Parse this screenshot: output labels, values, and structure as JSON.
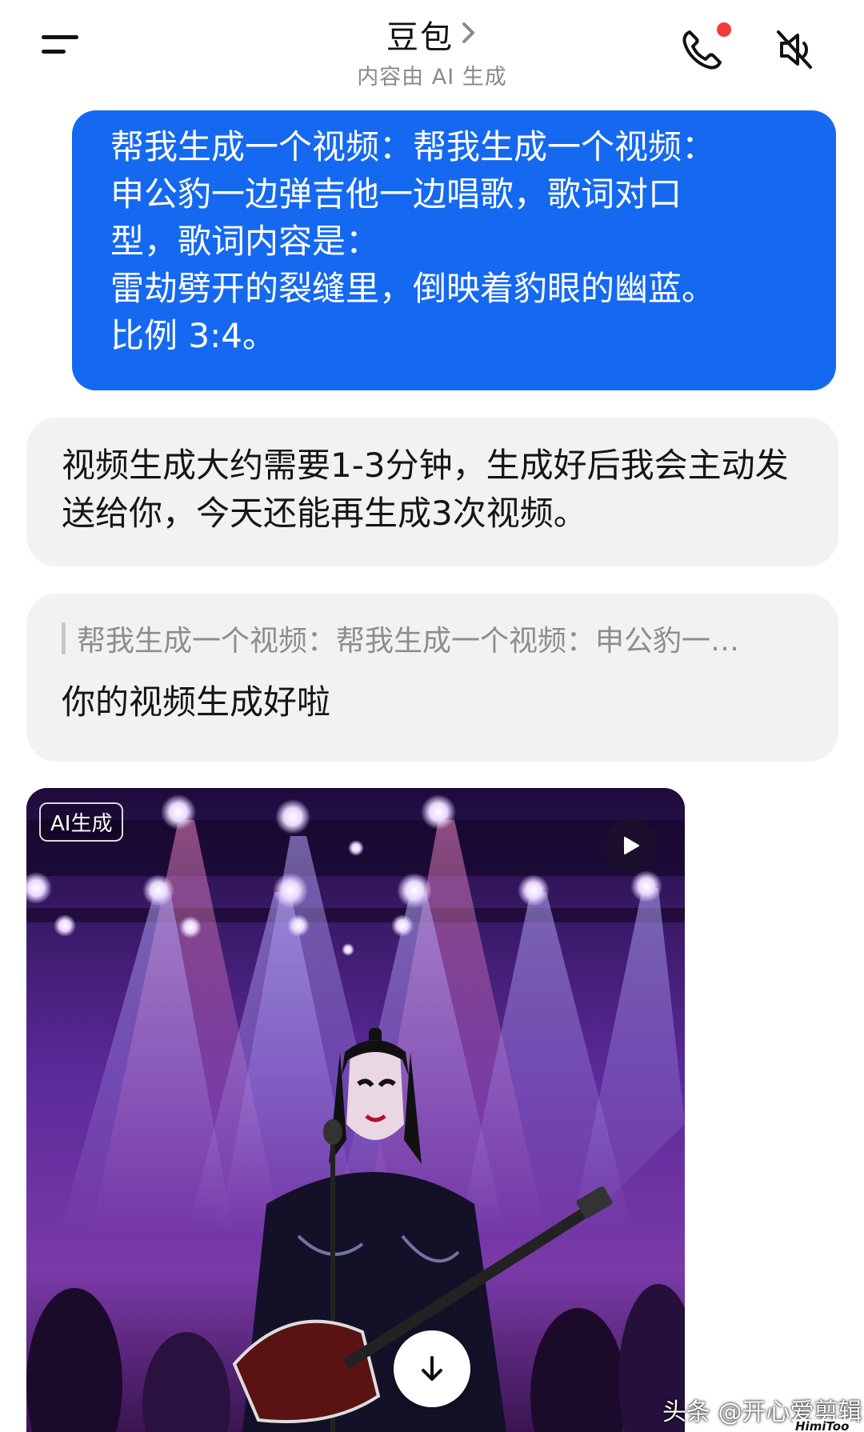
{
  "header": {
    "title": "豆包",
    "subtitle": "内容由 AI 生成",
    "icons": [
      "menu-icon",
      "chevron-right-icon",
      "phone-icon",
      "mute-icon"
    ],
    "notification_color": "#f23b3b"
  },
  "messages": {
    "user_prompt": "帮我生成一个视频：帮我生成一个视频：\n申公豹一边弹吉他一边唱歌，歌词对口\n型，歌词内容是：\n雷劫劈开的裂缝里，倒映着豹眼的幽蓝。\n比例 3:4。",
    "bot_reply": "视频生成大约需要1-3分钟，生成好后我会主动发送给你，今天还能再生成3次视频。",
    "quote_text": "帮我生成一个视频：帮我生成一个视频：申公豹一…",
    "bot_done": "你的视频生成好啦"
  },
  "video": {
    "badge": "AI生成",
    "icons": [
      "play-icon",
      "download-icon"
    ]
  },
  "watermark": {
    "text": "头条 @开心爱剪辑",
    "small": "HimiToo"
  },
  "colors": {
    "user_bubble": "#1569f0",
    "bot_bubble": "#f2f2f3"
  }
}
